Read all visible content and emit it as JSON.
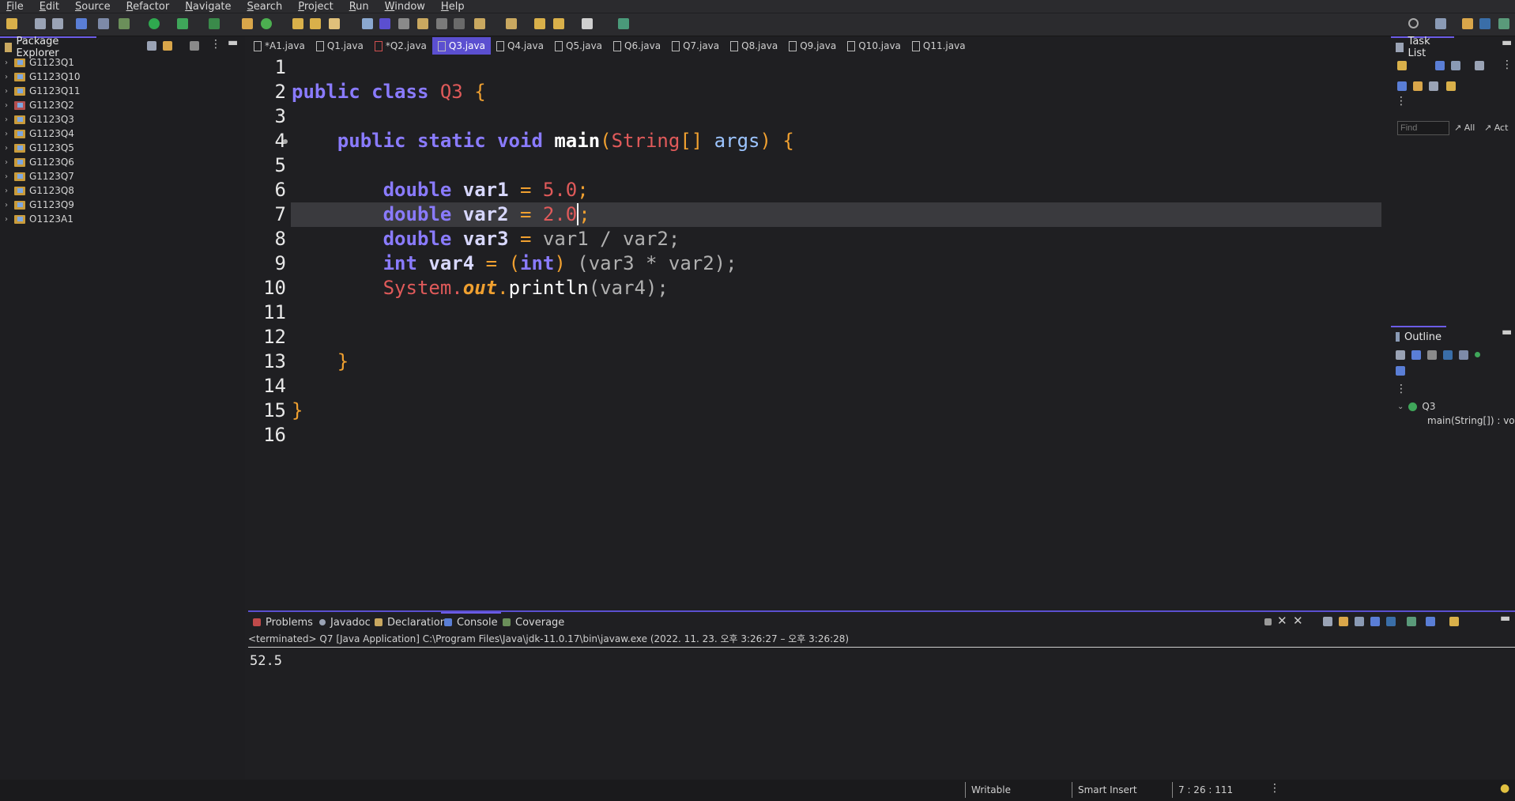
{
  "menubar": {
    "items": [
      "File",
      "Edit",
      "Source",
      "Refactor",
      "Navigate",
      "Search",
      "Project",
      "Run",
      "Window",
      "Help"
    ]
  },
  "package_explorer": {
    "title": "Package Explorer",
    "projects": [
      {
        "name": "G1123Q1",
        "error": false
      },
      {
        "name": "G1123Q10",
        "error": false
      },
      {
        "name": "G1123Q11",
        "error": false
      },
      {
        "name": "G1123Q2",
        "error": true
      },
      {
        "name": "G1123Q3",
        "error": false
      },
      {
        "name": "G1123Q4",
        "error": false
      },
      {
        "name": "G1123Q5",
        "error": false
      },
      {
        "name": "G1123Q6",
        "error": false
      },
      {
        "name": "G1123Q7",
        "error": false
      },
      {
        "name": "G1123Q8",
        "error": false
      },
      {
        "name": "G1123Q9",
        "error": false
      },
      {
        "name": "O1123A1",
        "error": false
      }
    ]
  },
  "editor_tabs": [
    "*A1.java",
    "Q1.java",
    "*Q2.java",
    "Q3.java",
    "Q4.java",
    "Q5.java",
    "Q6.java",
    "Q7.java",
    "Q8.java",
    "Q9.java",
    "Q10.java",
    "Q11.java"
  ],
  "active_tab": "Q3.java",
  "code": {
    "line_numbers": [
      "1",
      "2",
      "3",
      "4",
      "5",
      "6",
      "7",
      "8",
      "9",
      "10",
      "11",
      "12",
      "13",
      "14",
      "15",
      "16"
    ],
    "l2": {
      "kw1": "public",
      "kw2": "class",
      "name": "Q3",
      "brace": "{"
    },
    "l4": {
      "kw1": "public",
      "kw2": "static",
      "kw3": "void",
      "method": "main",
      "type": "String",
      "arr": "[]",
      "param": "args",
      "brace": "{"
    },
    "l6": {
      "type": "double",
      "var": "var1",
      "eq": "=",
      "val": "5.0",
      "semi": ";"
    },
    "l7": {
      "type": "double",
      "var": "var2",
      "eq": "=",
      "val": "2.0",
      "semi": ";"
    },
    "l8": {
      "type": "double",
      "var": "var3",
      "eq": "=",
      "expr": "var1 / var2;"
    },
    "l9": {
      "type": "int",
      "var": "var4",
      "eq": "=",
      "cast_open": "(",
      "cast": "int",
      "cast_close": ")",
      "expr": "(var3 * var2);"
    },
    "l10": {
      "cls": "System.",
      "field": "out",
      "dot": ".",
      "method": "println",
      "args": "(var4);"
    },
    "l13": {
      "brace": "}"
    },
    "l15": {
      "brace": "}"
    }
  },
  "task_list": {
    "title": "Task List",
    "find_placeholder": "Find",
    "all_label": "All",
    "act_label": "Act"
  },
  "outline": {
    "title": "Outline",
    "class_name": "Q3",
    "member": "main(String[]) : void"
  },
  "bottom_panel": {
    "tabs": [
      "Problems",
      "Javadoc",
      "Declaration",
      "Console",
      "Coverage"
    ],
    "active": "Console",
    "console_header": "<terminated> Q7 [Java Application] C:\\Program Files\\Java\\jdk-11.0.17\\bin\\javaw.exe  (2022. 11. 23. 오후 3:26:27 – 오후 3:26:28)",
    "output": "52.5"
  },
  "statusbar": {
    "writable": "Writable",
    "insert_mode": "Smart Insert",
    "position": "7 : 26 : 111"
  },
  "colors": {
    "accent": "#6c5ce7",
    "keyword": "#8a7bff",
    "number": "#e05a5a",
    "brace": "#f0a030"
  }
}
